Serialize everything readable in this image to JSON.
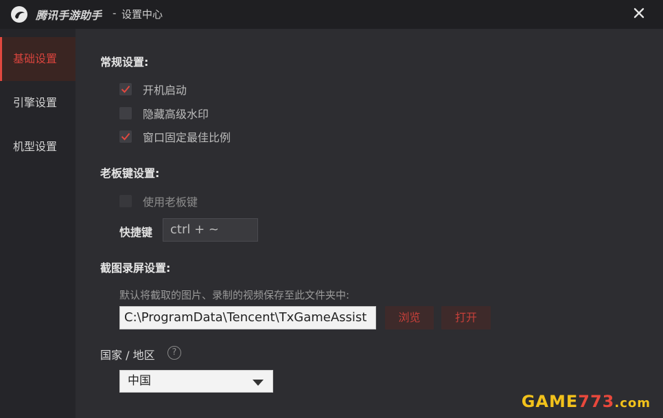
{
  "window": {
    "app_name": "腾讯手游助手",
    "separator": "-",
    "subtitle": "设置中心",
    "close_icon": "close-icon"
  },
  "sidebar": {
    "items": [
      {
        "label": "基础设置",
        "active": true
      },
      {
        "label": "引擎设置",
        "active": false
      },
      {
        "label": "机型设置",
        "active": false
      }
    ]
  },
  "general": {
    "title": "常规设置:",
    "options": [
      {
        "label": "开机启动",
        "checked": true
      },
      {
        "label": "隐藏高级水印",
        "checked": false
      },
      {
        "label": "窗口固定最佳比例",
        "checked": true
      }
    ]
  },
  "boss_key": {
    "title": "老板键设置:",
    "use_label": "使用老板键",
    "use_checked": false,
    "hotkey_label": "快捷键",
    "hotkey_value": "ctrl + ~"
  },
  "capture": {
    "title": "截图录屏设置:",
    "description": "默认将截取的图片、录制的视频保存至此文件夹中:",
    "path": "C:\\ProgramData\\Tencent\\TxGameAssist",
    "browse_label": "浏览",
    "open_label": "打开"
  },
  "region": {
    "title": "国家 / 地区",
    "help_icon": "?",
    "selected": "中国"
  },
  "watermark": {
    "text_a": "GAME",
    "text_b": "773",
    "text_c": ".com"
  },
  "colors": {
    "accent": "#e0483f",
    "background": "#2d2d31",
    "sidebar": "#252529",
    "titlebar": "#1f1f22"
  }
}
